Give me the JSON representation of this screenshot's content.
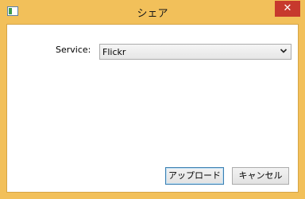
{
  "window": {
    "title": "シェア",
    "close_symbol": "✕"
  },
  "form": {
    "service_label": "Service:",
    "service_selected": "Flickr"
  },
  "buttons": {
    "upload_label": "アップロード",
    "cancel_label": "キャンセル"
  },
  "colors": {
    "frame": "#f2c05a",
    "close": "#c7392d",
    "default_button_border": "#3c7fb1"
  },
  "icons": {
    "app": "window-app-icon",
    "close": "close-icon",
    "dropdown": "chevron-down-icon"
  }
}
